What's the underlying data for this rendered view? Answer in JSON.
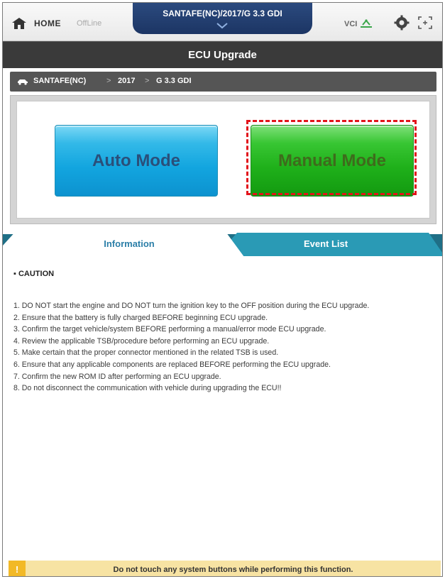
{
  "topbar": {
    "home_label": "HOME",
    "status_label": "OffLine",
    "vehicle_summary": "SANTAFE(NC)/2017/G 3.3 GDI",
    "vci_label": "VCI"
  },
  "page": {
    "title": "ECU Upgrade"
  },
  "breadcrumb": {
    "items": [
      "SANTAFE(NC)",
      "2017",
      "G 3.3 GDI"
    ],
    "separator": ">"
  },
  "modes": {
    "auto_label": "Auto Mode",
    "manual_label": "Manual Mode"
  },
  "tabs": {
    "information": "Information",
    "event_list": "Event List"
  },
  "caution": {
    "title": "▪ CAUTION",
    "items": [
      "1. DO NOT start the engine and DO NOT turn the ignition key to the OFF position during the ECU upgrade.",
      "2. Ensure that the battery is fully charged BEFORE beginning ECU upgrade.",
      "3. Confirm the target vehicle/system BEFORE performing a manual/error mode ECU upgrade.",
      "4. Review the applicable TSB/procedure before performing an ECU upgrade.",
      "5. Make certain that the proper connector mentioned in the related TSB is used.",
      "6. Ensure that any applicable components are replaced BEFORE performing the ECU upgrade.",
      "7. Confirm the new ROM ID after performing an ECU upgrade.",
      "8. Do not disconnect the communication with vehicle during upgrading the ECU!!"
    ]
  },
  "footer": {
    "icon_text": "!",
    "message": "Do not touch any system buttons while performing this function."
  },
  "colors": {
    "auto_button": "#12a5df",
    "manual_button": "#1fb01a",
    "highlight": "#e2141b",
    "tab_active_text": "#2c7fa8",
    "tab_inactive": "#1f7f98",
    "vehicle_tab": "#1c3564"
  },
  "icons": {
    "home": "home-icon",
    "vci": "vci-connection-icon",
    "settings": "gear-icon",
    "screen": "expand-icon",
    "breadcrumb": "car-icon",
    "footer": "warning-icon"
  }
}
